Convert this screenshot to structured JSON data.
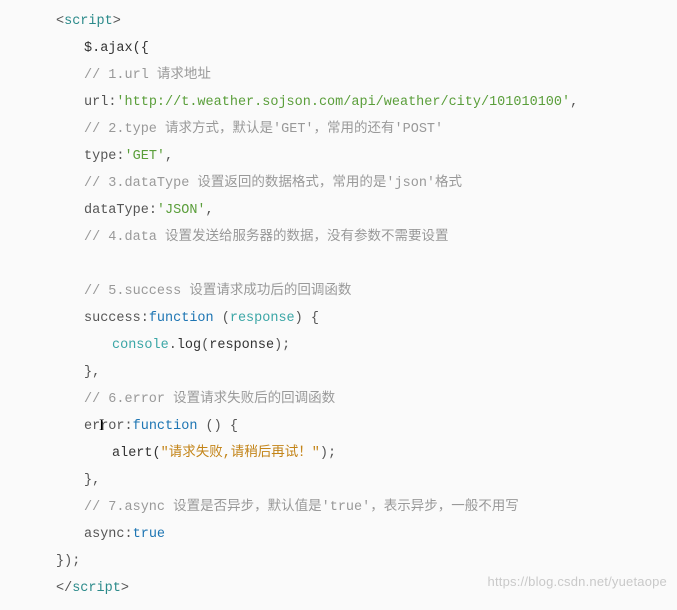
{
  "code": {
    "open_tag_open": "<",
    "open_tag_name": "script",
    "open_tag_close": ">",
    "close_tag_open": "</",
    "close_tag_name": "script",
    "close_tag_close": ">",
    "ajax_call": "$.ajax({",
    "comment1": "// 1.url 请求地址",
    "url_key": "url",
    "colon": ":",
    "url_value": "'http://t.weather.sojson.com/api/weather/city/101010100'",
    "comma": ",",
    "comment2": "// 2.type 请求方式，默认是'GET'，常用的还有'POST'",
    "type_key": "type",
    "type_value": "'GET'",
    "comment3": "// 3.dataType 设置返回的数据格式，常用的是'json'格式",
    "dataType_key": "dataType",
    "dataType_value": "'JSON'",
    "comment4": "// 4.data 设置发送给服务器的数据，没有参数不需要设置",
    "comment5": "// 5.success 设置请求成功后的回调函数",
    "success_key": "success",
    "function_kw": "function",
    "success_param": "response",
    "open_paren": " (",
    "close_paren_brace": ") {",
    "console_obj": "console",
    "dot": ".",
    "log_fn": "log",
    "log_open": "(",
    "log_arg": "response",
    "log_close": ");",
    "close_brace_comma": "},",
    "comment6": "// 6.error 设置请求失败后的回调函数",
    "error_key": "error",
    "empty_parens_brace": " () {",
    "alert_fn": "alert(",
    "alert_msg": "\"请求失败,请稍后再试！\"",
    "alert_close": ");",
    "comment7": "// 7.async 设置是否异步，默认值是'true'，表示异步，一般不用写",
    "async_key": "async",
    "async_value": "true",
    "closing": "});"
  },
  "watermark": "https://blog.csdn.net/yuetaope"
}
